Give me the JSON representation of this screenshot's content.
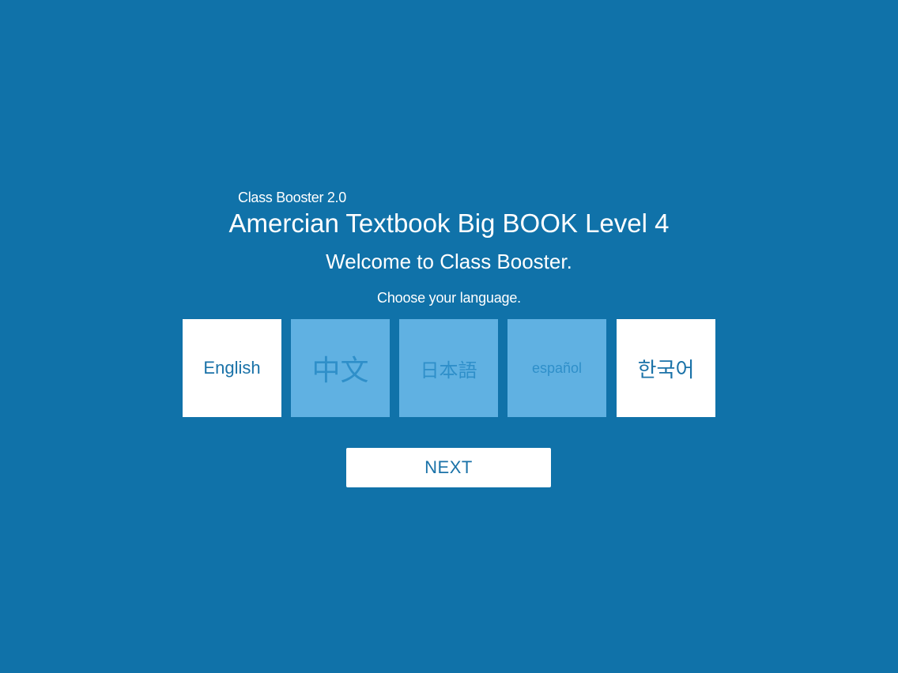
{
  "header": {
    "app_name": "Class Booster 2.0",
    "book_title": "Amercian Textbook Big BOOK Level 4",
    "welcome": "Welcome to Class Booster."
  },
  "language_picker": {
    "prompt": "Choose your language.",
    "options": [
      {
        "label": "English",
        "state": "active"
      },
      {
        "label": "中文",
        "state": "inactive"
      },
      {
        "label": "日本語",
        "state": "inactive"
      },
      {
        "label": "español",
        "state": "inactive"
      },
      {
        "label": "한국어",
        "state": "active"
      }
    ]
  },
  "actions": {
    "next_label": "NEXT"
  },
  "colors": {
    "background": "#1072a9",
    "tile_active": "#ffffff",
    "tile_inactive": "#60b1e2",
    "accent_text": "#1a72a8"
  }
}
